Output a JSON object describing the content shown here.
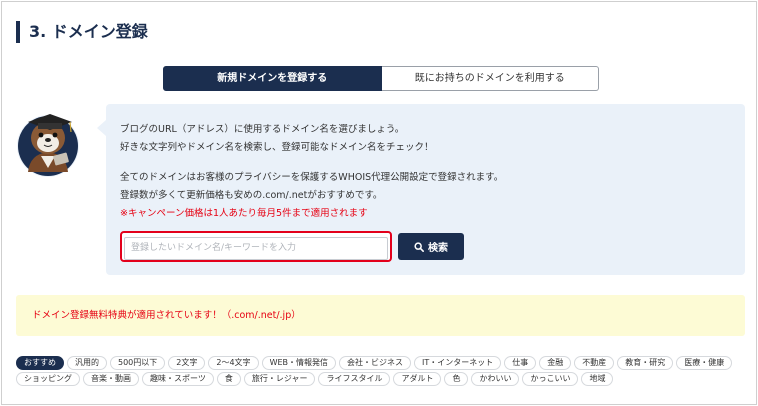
{
  "section": {
    "title": "3. ドメイン登録"
  },
  "tabs": [
    {
      "label": "新規ドメインを登録する",
      "active": true
    },
    {
      "label": "既にお持ちのドメインを利用する",
      "active": false
    }
  ],
  "info": {
    "line1": "ブログのURL（アドレス）に使用するドメイン名を選びましょう。",
    "line2": "好きな文字列やドメイン名を検索し、登録可能なドメイン名をチェック！",
    "line3": "全てのドメインはお客様のプライバシーを保護するWHOIS代理公開設定で登録されます。",
    "line4": "登録数が多くて更新価格も安めの.com/.netがおすすめです。",
    "campaign": "※キャンペーン価格は1人あたり毎月5件まで適用されます"
  },
  "search": {
    "placeholder": "登録したいドメイン名/キーワードを入力",
    "value": "",
    "button_label": "検索",
    "highlight_color": "#e3001b"
  },
  "notice": {
    "text": "ドメイン登録無料特典が適用されています！（.com/.net/.jp）"
  },
  "categories": [
    {
      "label": "おすすめ",
      "active": true
    },
    {
      "label": "汎用的",
      "active": false
    },
    {
      "label": "500円以下",
      "active": false
    },
    {
      "label": "2文字",
      "active": false
    },
    {
      "label": "2〜4文字",
      "active": false
    },
    {
      "label": "WEB・情報発信",
      "active": false
    },
    {
      "label": "会社・ビジネス",
      "active": false
    },
    {
      "label": "IT・インターネット",
      "active": false
    },
    {
      "label": "仕事",
      "active": false
    },
    {
      "label": "金融",
      "active": false
    },
    {
      "label": "不動産",
      "active": false
    },
    {
      "label": "教育・研究",
      "active": false
    },
    {
      "label": "医療・健康",
      "active": false
    },
    {
      "label": "ショッピング",
      "active": false
    },
    {
      "label": "音楽・動画",
      "active": false
    },
    {
      "label": "趣味・スポーツ",
      "active": false
    },
    {
      "label": "食",
      "active": false
    },
    {
      "label": "旅行・レジャー",
      "active": false
    },
    {
      "label": "ライフスタイル",
      "active": false
    },
    {
      "label": "アダルト",
      "active": false
    },
    {
      "label": "色",
      "active": false
    },
    {
      "label": "かわいい",
      "active": false
    },
    {
      "label": "かっこいい",
      "active": false
    },
    {
      "label": "地域",
      "active": false
    }
  ],
  "colors": {
    "navy": "#1b2e4f",
    "red": "#e60012",
    "info_bg": "#eaf1f9",
    "notice_bg": "#fdfbd5"
  },
  "icons": {
    "mascot": "otter-mascot-graduation-cap",
    "search": "search-icon"
  }
}
